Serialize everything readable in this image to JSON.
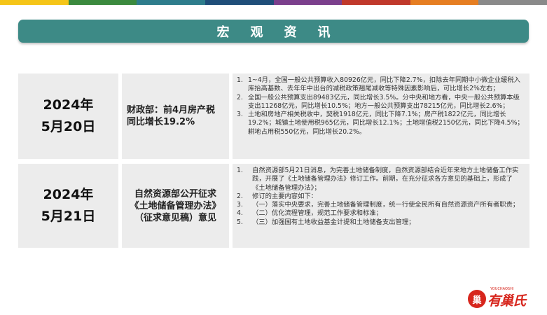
{
  "topbar_colors": [
    "#f5c518",
    "#3b8a3e",
    "#2e7d8c",
    "#1f4e79",
    "#7b3f8c",
    "#c0392b",
    "#e67e22",
    "#8a8a8a"
  ],
  "page_title": "宏观资讯",
  "rows": [
    {
      "date_line1": "2024年",
      "date_line2": "5月20日",
      "headline_lines": [
        "财政部：前4月房产税",
        "同比增长19.2%"
      ],
      "items": [
        {
          "num": "1.",
          "text": "1~4月，全国一般公共预算收入80926亿元，同比下降2.7%，扣除去年同期中小微企业缓税入库抬高基数、去年年中出台的减税政策翘尾减收等特殊因素影响后，可比增长2%左右；"
        },
        {
          "num": "2.",
          "text": "全国一般公共预算支出89483亿元，同比增长3.5%。分中央和地方看，中央一般公共预算本级支出11268亿元，同比增长10.5%；地方一般公共预算支出78215亿元，同比增长2.6%；"
        },
        {
          "num": "3.",
          "text": "土地和房地产相关税收中，契税1918亿元，同比下降7.1%；房产税1822亿元，同比增长19.2%；城镇土地使用税965亿元，同比增长12.1%；土地增值税2150亿元，同比下降4.5%；耕地占用税550亿元，同比增长20.2%。"
        }
      ]
    },
    {
      "date_line1": "2024年",
      "date_line2": "5月21日",
      "headline_lines": [
        "自然资源部公开征求",
        "《土地储备管理办法》",
        "（征求意见稿）意见"
      ],
      "items": [
        {
          "num": "1.",
          "text": "自然资源部5月21日消息，为完善土地储备制度，自然资源部结合近年来地方土地储备工作实践，开展了《土地储备管理办法》修订工作。前期，在充分征求各方意见的基础上，形成了《土地储备管理办法》；"
        },
        {
          "num": "2.",
          "text": "修订的主要内容如下："
        },
        {
          "num": "3.",
          "text": "（一）落实中央要求，完善土地储备管理制度，统一行使全民所有自然资源资产所有者职责；"
        },
        {
          "num": "4.",
          "text": "（二）优化流程管理，规范工作要求和标准；"
        },
        {
          "num": "5.",
          "text": "（三）加强国有土地收益基金计提和土地储备支出管理；"
        }
      ]
    }
  ],
  "logo": {
    "icon_char": "巢",
    "brand_text": "有巢氏",
    "sub_text": "YOUCHAOSHI",
    "color": "#d7261d"
  }
}
